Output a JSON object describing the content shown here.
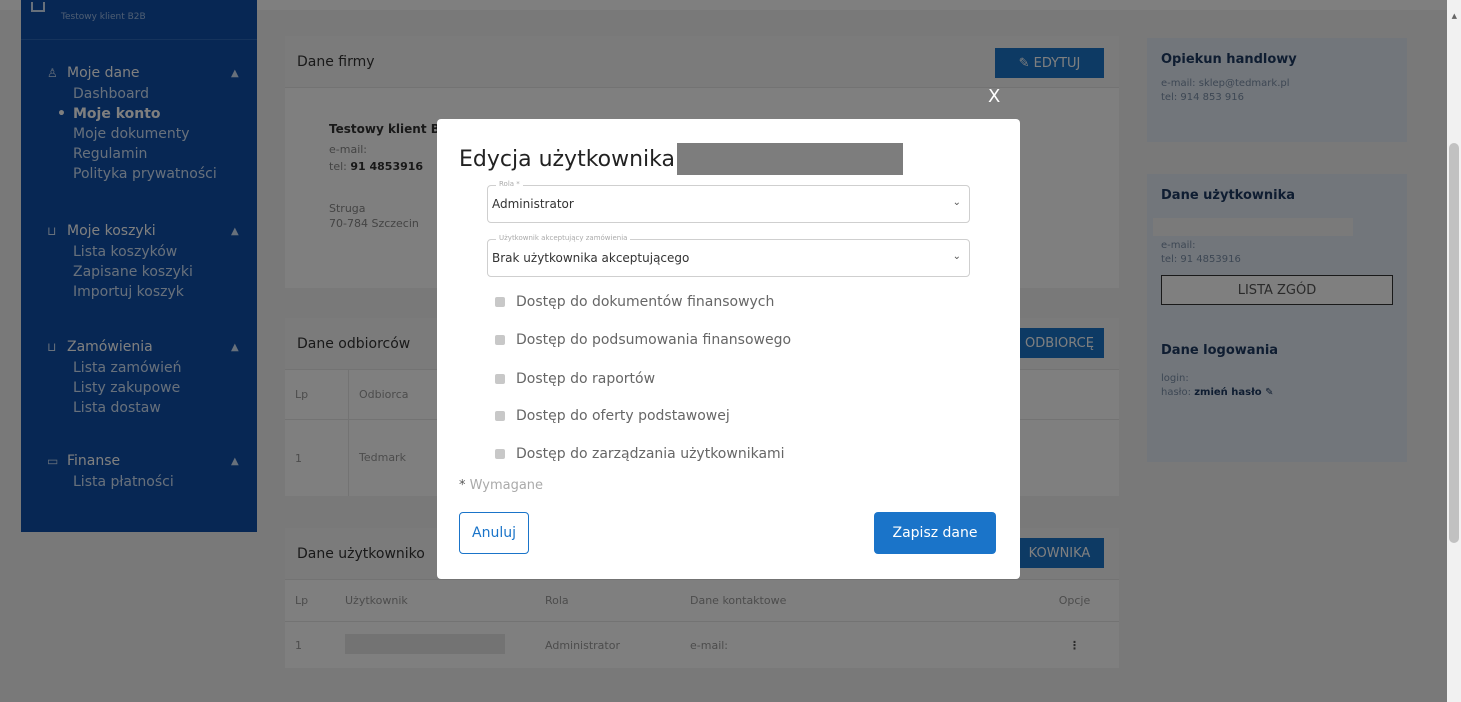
{
  "sidebar": {
    "brand": "Testowy klient B2B",
    "sections": [
      {
        "label": "Moje dane",
        "items": [
          "Dashboard",
          "Moje konto",
          "Moje dokumenty",
          "Regulamin",
          "Polityka prywatności"
        ]
      },
      {
        "label": "Moje koszyki",
        "items": [
          "Lista koszyków",
          "Zapisane koszyki",
          "Importuj koszyk"
        ]
      },
      {
        "label": "Zamówienia",
        "items": [
          "Lista zamówień",
          "Listy zakupowe",
          "Lista dostaw"
        ]
      },
      {
        "label": "Finanse",
        "items": [
          "Lista płatności"
        ]
      }
    ]
  },
  "company": {
    "header": "Dane firmy",
    "edit_btn": "✎ EDYTUJ",
    "name": "Testowy klient B",
    "email": "e-mail:",
    "tel_label": "tel:",
    "tel_value": "91 4853916",
    "street": "Struga",
    "city": "70-784 Szczecin"
  },
  "recipients": {
    "header": "Dane odbiorców",
    "btn": "ODBIORCĘ",
    "col_lp": "Lp",
    "col_name": "Odbiorca",
    "row_lp": "1",
    "row_name": "Tedmark"
  },
  "users": {
    "header": "Dane użytkowniko",
    "btn": "KOWNIKA",
    "cols": [
      "Lp",
      "Użytkownik",
      "Rola",
      "Dane kontaktowe",
      "Opcje"
    ],
    "row": {
      "lp": "1",
      "role": "Administrator",
      "contact": "e-mail:",
      "options": "⋮"
    }
  },
  "right": {
    "handler_title": "Opiekun handlowy",
    "handler_email": "e-mail: sklep@tedmark.pl",
    "handler_tel": "tel: 914 853 916",
    "user_title": "Dane użytkownika",
    "user_email": "e-mail:",
    "user_tel": "tel: 91 4853916",
    "consents_btn": "LISTA ZGÓD",
    "login_title": "Dane logowania",
    "login_label": "login:",
    "password_label": "hasło:",
    "password_link": "zmień hasło ✎"
  },
  "modal": {
    "close": "X",
    "title": "Edycja użytkownika",
    "role_label": "Rola *",
    "role_value": "Administrator",
    "approver_label": "Użytkownik akceptujący zamówienia",
    "approver_value": "Brak użytkownika akceptującego",
    "permissions": [
      "Dostęp do dokumentów finansowych",
      "Dostęp do podsumowania finansowego",
      "Dostęp do raportów",
      "Dostęp do oferty podstawowej",
      "Dostęp do zarządzania użytkownikami"
    ],
    "required_note": "Wymagane",
    "cancel": "Anuluj",
    "save": "Zapisz dane"
  },
  "colors": {
    "primary": "#1a74c9",
    "sidebar": "#0f4fa8"
  },
  "icons": [
    "user-icon",
    "cart-icon",
    "basket-icon",
    "wallet-icon",
    "pencil-icon",
    "chevron-up-icon",
    "chevron-down-icon",
    "close-icon"
  ]
}
